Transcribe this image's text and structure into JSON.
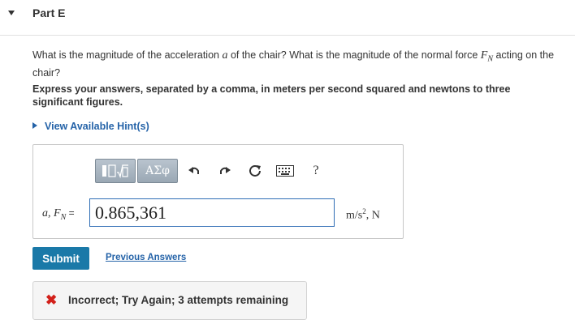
{
  "part": {
    "title": "Part E",
    "caret_icon": "caret-down-icon"
  },
  "question": {
    "prefix": "What is the magnitude of the acceleration ",
    "var_a": "a",
    "middle": " of the chair? What is the magnitude of the normal force ",
    "var_F": "F",
    "var_F_sub": "N",
    "suffix": " acting on the chair?"
  },
  "instruction": "Express your answers, separated by a comma, in meters per second squared and newtons to three significant figures.",
  "hints": {
    "label": "View Available Hint(s)"
  },
  "toolbar": {
    "math_button_icon": "templates-icon",
    "greek_label": "ΑΣφ",
    "undo_icon": "undo-icon",
    "redo_icon": "redo-icon",
    "reset_icon": "reset-icon",
    "keyboard_icon": "keyboard-icon",
    "help_label": "?"
  },
  "answer": {
    "label_a": "a",
    "label_sep": ", ",
    "label_F": "F",
    "label_F_sub": "N",
    "label_eq": " =",
    "value": "0.865,361",
    "units_base": "m/s",
    "units_exp": "2",
    "units_tail": ", N"
  },
  "actions": {
    "submit_label": "Submit",
    "previous_answers_label": "Previous Answers"
  },
  "feedback": {
    "icon": "x-icon",
    "symbol": "✖",
    "text": "Incorrect; Try Again; 3 attempts remaining",
    "icon_color": "#d2201a"
  },
  "colors": {
    "link": "#2563a8",
    "submit_bg": "#1a79a8",
    "input_border": "#2f6db5"
  }
}
